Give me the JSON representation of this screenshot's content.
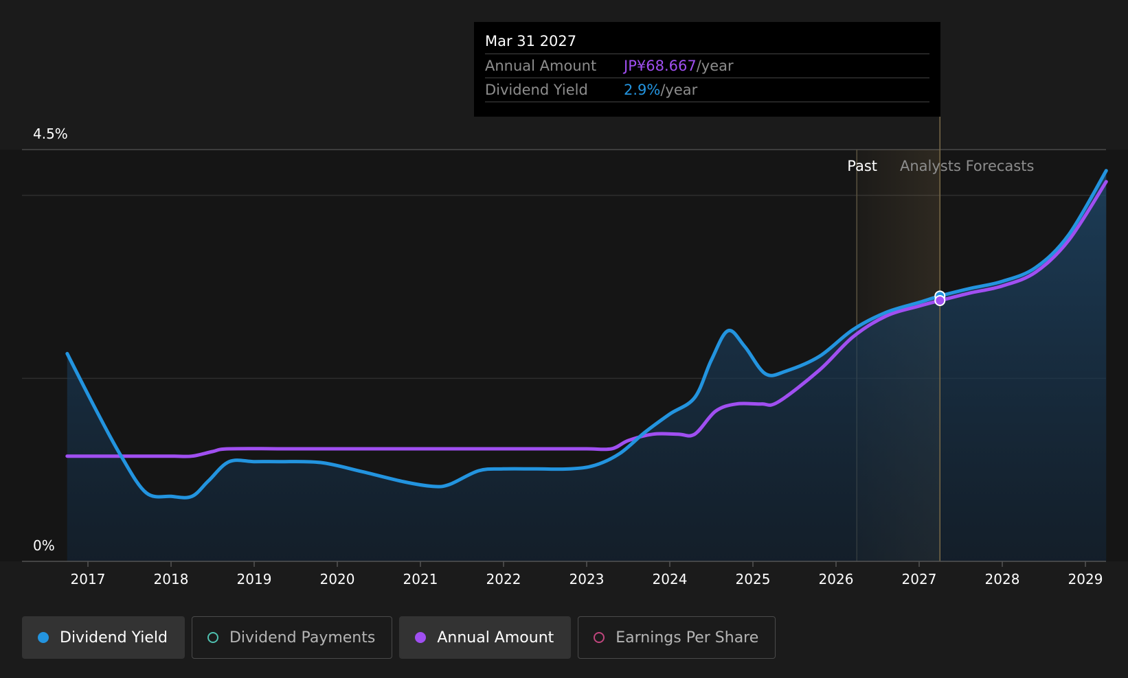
{
  "chart_data": {
    "type": "line",
    "y_axis": {
      "min_label": "0%",
      "max_label": "4.5%",
      "ylim": [
        0,
        4.5
      ]
    },
    "x_ticks": [
      "2017",
      "2018",
      "2019",
      "2020",
      "2021",
      "2022",
      "2023",
      "2024",
      "2025",
      "2026",
      "2027",
      "2028",
      "2029"
    ],
    "past_label": "Past",
    "forecast_label": "Analysts Forecasts",
    "forecast_start": 2026.25,
    "hover_x": 2027.25,
    "series": [
      {
        "name": "Dividend Yield",
        "unit": "%",
        "color": "#2394df",
        "x": [
          2016.75,
          2017.1,
          2017.4,
          2017.7,
          2018.0,
          2018.25,
          2018.45,
          2018.7,
          2019.0,
          2019.3,
          2019.8,
          2020.3,
          2020.8,
          2021.15,
          2021.35,
          2021.7,
          2022.0,
          2022.4,
          2022.8,
          2023.1,
          2023.4,
          2023.7,
          2024.0,
          2024.3,
          2024.5,
          2024.7,
          2024.9,
          2025.15,
          2025.4,
          2025.8,
          2026.2,
          2026.6,
          2027.0,
          2027.25,
          2027.6,
          2028.0,
          2028.4,
          2028.8,
          2029.25
        ],
        "y": [
          2.27,
          1.65,
          1.15,
          0.75,
          0.71,
          0.71,
          0.88,
          1.09,
          1.09,
          1.09,
          1.08,
          0.98,
          0.87,
          0.82,
          0.84,
          0.99,
          1.01,
          1.01,
          1.01,
          1.05,
          1.18,
          1.41,
          1.61,
          1.79,
          2.2,
          2.52,
          2.35,
          2.05,
          2.08,
          2.24,
          2.53,
          2.72,
          2.83,
          2.9,
          2.98,
          3.06,
          3.21,
          3.57,
          4.27
        ]
      },
      {
        "name": "Annual Amount",
        "unit": "JP¥",
        "color": "#a04ff1",
        "x": [
          2016.75,
          2017.5,
          2018.0,
          2018.25,
          2018.5,
          2018.7,
          2019.5,
          2020.5,
          2021.5,
          2022.5,
          2023.0,
          2023.3,
          2023.5,
          2023.8,
          2024.1,
          2024.3,
          2024.55,
          2024.8,
          2025.1,
          2025.3,
          2025.8,
          2026.2,
          2026.6,
          2027.0,
          2027.25,
          2027.6,
          2028.0,
          2028.4,
          2028.8,
          2029.25
        ],
        "y": [
          1.15,
          1.15,
          1.15,
          1.15,
          1.2,
          1.23,
          1.23,
          1.23,
          1.23,
          1.23,
          1.23,
          1.23,
          1.32,
          1.39,
          1.39,
          1.39,
          1.64,
          1.72,
          1.72,
          1.74,
          2.09,
          2.45,
          2.68,
          2.79,
          2.85,
          2.93,
          3.01,
          3.16,
          3.51,
          4.15
        ]
      }
    ],
    "tooltip": {
      "date": "Mar 31 2027",
      "rows": [
        {
          "label": "Annual Amount",
          "value": "JP¥68.667",
          "unit": "/year"
        },
        {
          "label": "Dividend Yield",
          "value": "2.9%",
          "unit": "/year"
        }
      ]
    }
  },
  "legend": [
    {
      "label": "Dividend Yield",
      "color": "#2394df",
      "active": true
    },
    {
      "label": "Dividend Payments",
      "color": "#4fc1b0",
      "active": false
    },
    {
      "label": "Annual Amount",
      "color": "#a04ff1",
      "active": true
    },
    {
      "label": "Earnings Per Share",
      "color": "#c0457d",
      "active": false
    }
  ]
}
